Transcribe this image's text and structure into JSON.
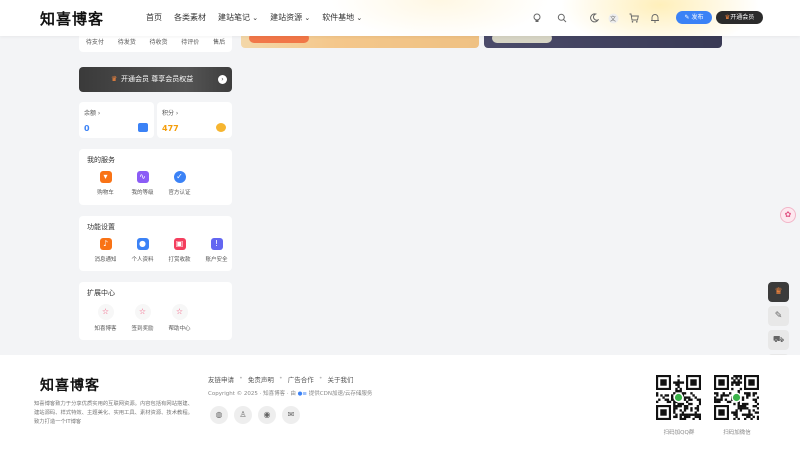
{
  "header": {
    "logo": "知喜博客",
    "nav": [
      {
        "label": "首页",
        "dropdown": false
      },
      {
        "label": "各类素材",
        "dropdown": false
      },
      {
        "label": "建站笔记",
        "dropdown": true
      },
      {
        "label": "建站资源",
        "dropdown": true
      },
      {
        "label": "软件基地",
        "dropdown": true
      }
    ],
    "publish_label": "发布",
    "vip_label": "开通会员",
    "icons": [
      "lightbulb-icon",
      "search-icon",
      "moon-icon",
      "translate-icon",
      "cart-icon",
      "bell-icon"
    ]
  },
  "orders": [
    "待支付",
    "待发货",
    "待收货",
    "待评价",
    "售后"
  ],
  "vip_bar": {
    "text": "开通会员 尊享会员权益"
  },
  "balance": {
    "label": "余额 ›",
    "value": "0"
  },
  "points": {
    "label": "积分 ›",
    "value": "477"
  },
  "services": {
    "title": "我的服务",
    "items": [
      {
        "label": "购物车",
        "icon": "basket-icon",
        "color": "#f97316"
      },
      {
        "label": "我的等级",
        "icon": "chart-icon",
        "color": "#8b5cf6"
      },
      {
        "label": "官方认证",
        "icon": "verified-icon",
        "color": "#3b82f6"
      }
    ]
  },
  "settings": {
    "title": "功能设置",
    "items": [
      {
        "label": "消息通知",
        "icon": "bell-icon",
        "color": "#f97316"
      },
      {
        "label": "个人资料",
        "icon": "user-icon",
        "color": "#3b82f6"
      },
      {
        "label": "打赏收款",
        "icon": "gift-icon",
        "color": "#f43f5e"
      },
      {
        "label": "账户安全",
        "icon": "shield-icon",
        "color": "#6366f1"
      }
    ]
  },
  "expand": {
    "title": "扩展中心",
    "items": [
      {
        "label": "知喜博客",
        "icon": "star-icon"
      },
      {
        "label": "签到奖励",
        "icon": "star-icon"
      },
      {
        "label": "帮助中心",
        "icon": "star-icon"
      }
    ]
  },
  "footer": {
    "logo": "知喜博客",
    "description": "知喜博客致力于分享优质实用的互联网资源。内容包括有网站搭建、建站源码、样式特效、主题美化、实用工具、素材资源、技术教程。致力打造一个IT博客",
    "links": [
      "友链申请",
      "免责声明",
      "广告合作",
      "关于我们"
    ],
    "copyright": "Copyright © 2025 · 知喜博客 · 由",
    "cdn_text": "提供CDN加速/云存储服务",
    "qr_labels": [
      "扫码加QQ群",
      "扫码加微信"
    ]
  }
}
